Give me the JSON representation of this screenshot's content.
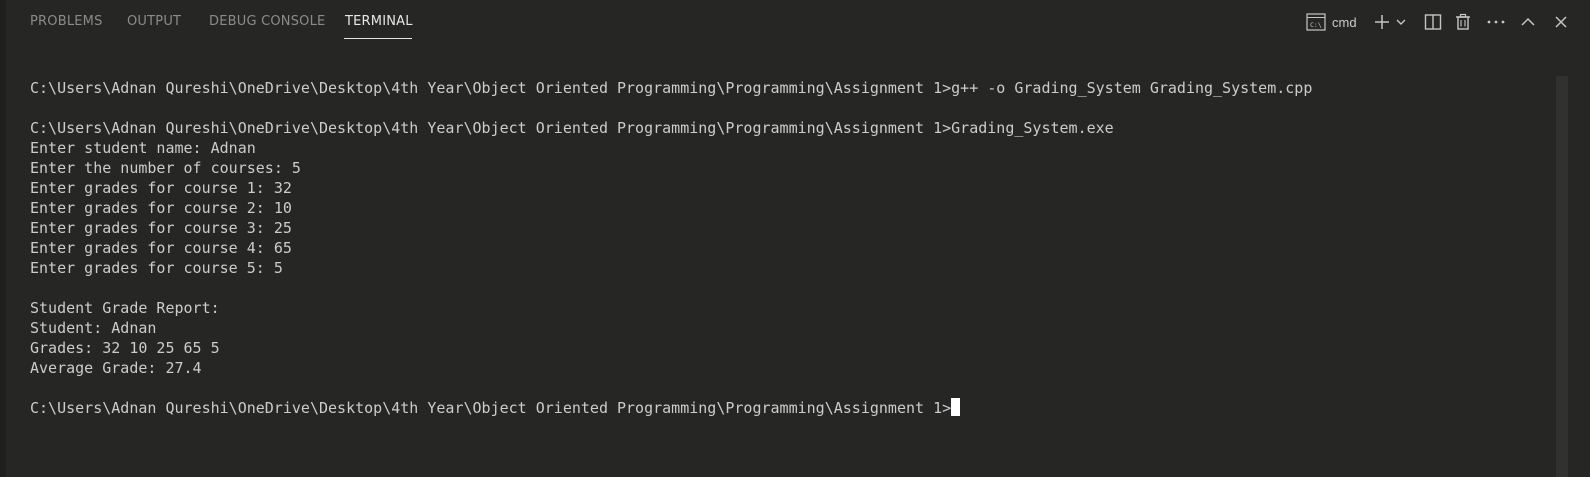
{
  "tabs": [
    {
      "label": "PROBLEMS"
    },
    {
      "label": "OUTPUT"
    },
    {
      "label": "DEBUG CONSOLE"
    },
    {
      "label": "TERMINAL",
      "active": true
    }
  ],
  "toolbar": {
    "shell": {
      "label": "cmd",
      "icon": "terminal-icon"
    },
    "new_terminal_icon": "plus-icon",
    "launch_profile_icon": "chevron-down-icon",
    "split_icon": "split-pane-icon",
    "kill_icon": "trash-icon",
    "more_icon": "ellipsis-icon",
    "maximize_icon": "chevron-up-icon",
    "close_icon": "close-icon"
  },
  "terminal": {
    "lines": [
      "C:\\Users\\Adnan Qureshi\\OneDrive\\Desktop\\4th Year\\Object Oriented Programming\\Programming\\Assignment 1>g++ -o Grading_System Grading_System.cpp",
      "",
      "C:\\Users\\Adnan Qureshi\\OneDrive\\Desktop\\4th Year\\Object Oriented Programming\\Programming\\Assignment 1>Grading_System.exe",
      "Enter student name: Adnan",
      "Enter the number of courses: 5",
      "Enter grades for course 1: 32",
      "Enter grades for course 2: 10",
      "Enter grades for course 3: 25",
      "Enter grades for course 4: 65",
      "Enter grades for course 5: 5",
      "",
      "Student Grade Report:",
      "Student: Adnan",
      "Grades: 32 10 25 65 5",
      "Average Grade: 27.4",
      "",
      "C:\\Users\\Adnan Qureshi\\OneDrive\\Desktop\\4th Year\\Object Oriented Programming\\Programming\\Assignment 1>"
    ]
  },
  "colors": {
    "background": "#262625",
    "text": "#cccccc",
    "inactive_tab": "#8b8b8b",
    "active_tab": "#e7e7e7",
    "cursor": "#ffffff"
  }
}
